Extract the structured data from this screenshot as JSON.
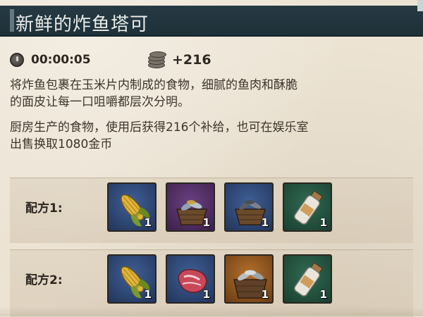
{
  "title": "新鲜的炸鱼塔可",
  "stats": {
    "time": "00:00:05",
    "reward": "+216",
    "time_icon": "clock-icon",
    "reward_icon": "coins-icon"
  },
  "description": {
    "line1": "将炸鱼包裹在玉米片内制成的食物，细腻的鱼肉和酥脆",
    "line2": "的面皮让每一口咀嚼都层次分明。",
    "line3": "厨房生产的食物，使用后获得216个补给，也可在娱乐室",
    "line4": "出售换取1080金币"
  },
  "recipes": [
    {
      "label": "配方1:",
      "items": [
        {
          "icon": "corn-icon",
          "rarity": "blue",
          "count": "1"
        },
        {
          "icon": "fish-basket-icon",
          "rarity": "purple",
          "count": "1"
        },
        {
          "icon": "fish-basket-icon",
          "rarity": "blue",
          "count": "1"
        },
        {
          "icon": "bottle-icon",
          "rarity": "green",
          "count": "1"
        }
      ]
    },
    {
      "label": "配方2:",
      "items": [
        {
          "icon": "corn-icon",
          "rarity": "blue",
          "count": "1"
        },
        {
          "icon": "steak-icon",
          "rarity": "blue",
          "count": "1"
        },
        {
          "icon": "fish-basket-icon",
          "rarity": "orange",
          "count": "1"
        },
        {
          "icon": "bottle-icon",
          "rarity": "green",
          "count": "1"
        }
      ]
    }
  ],
  "colors": {
    "title_bar": "#263a43",
    "rarity_blue": "#3f5f96",
    "rarity_purple": "#6a3f82",
    "rarity_green": "#2f6a52",
    "rarity_orange": "#b4702c"
  }
}
